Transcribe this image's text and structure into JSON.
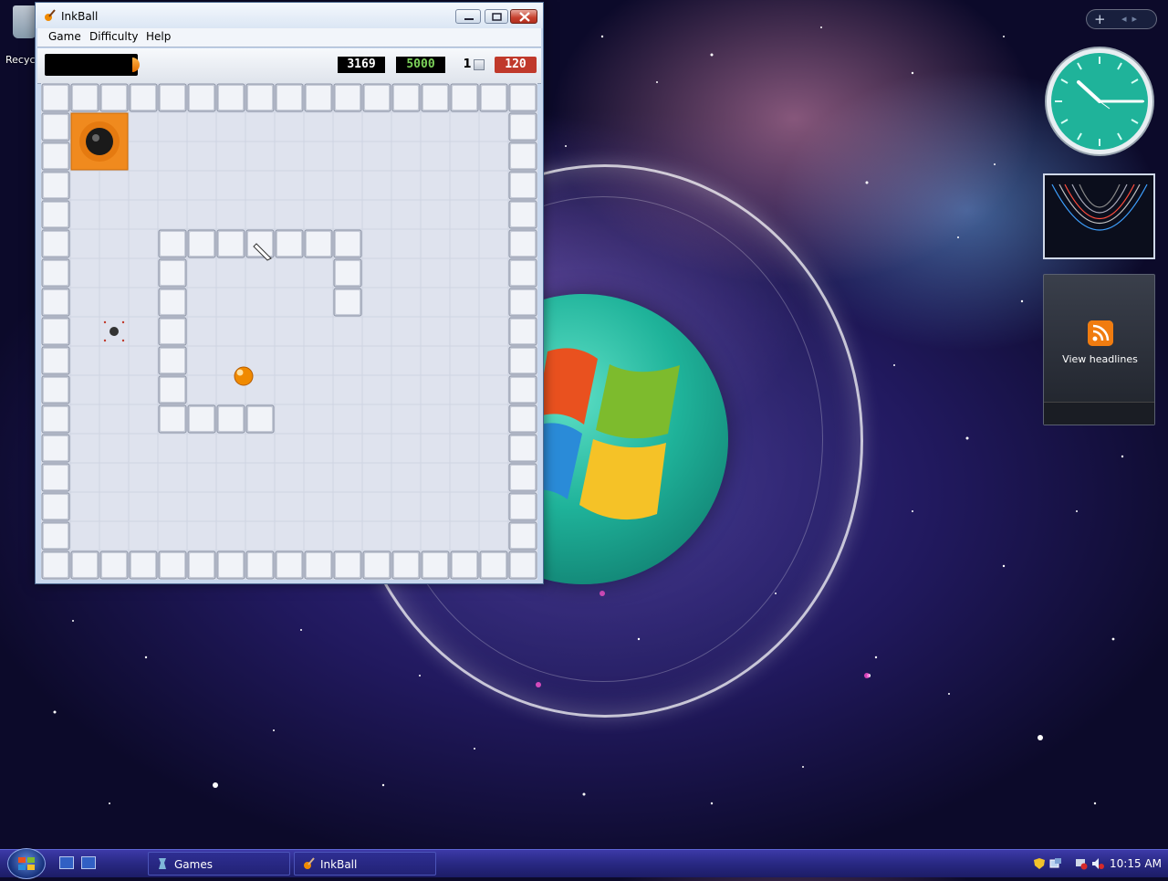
{
  "desktop": {
    "recycle_bin_label": "Recyc"
  },
  "window": {
    "title": "InkBall",
    "menu": [
      "Game",
      "Difficulty",
      "Help"
    ]
  },
  "scorebar": {
    "score": "3169",
    "target": "5000",
    "lives": "1",
    "time": "120"
  },
  "gadgets": {
    "feed_label": "View headlines"
  },
  "taskbar": {
    "items": [
      {
        "label": "Games"
      },
      {
        "label": "InkBall"
      }
    ],
    "clock": "10:15 AM"
  },
  "colors": {
    "score_green": "#7cd25a",
    "time_red": "#c0392b",
    "ball_orange": "#f08a00",
    "hole_orange": "#f08a1e",
    "clock_teal": "#1fb39a",
    "window_frame": "#c9d8ee"
  },
  "icons": {
    "window": "inkball-app-icon",
    "feed": "rss-icon",
    "start": "windows-start-orb"
  }
}
